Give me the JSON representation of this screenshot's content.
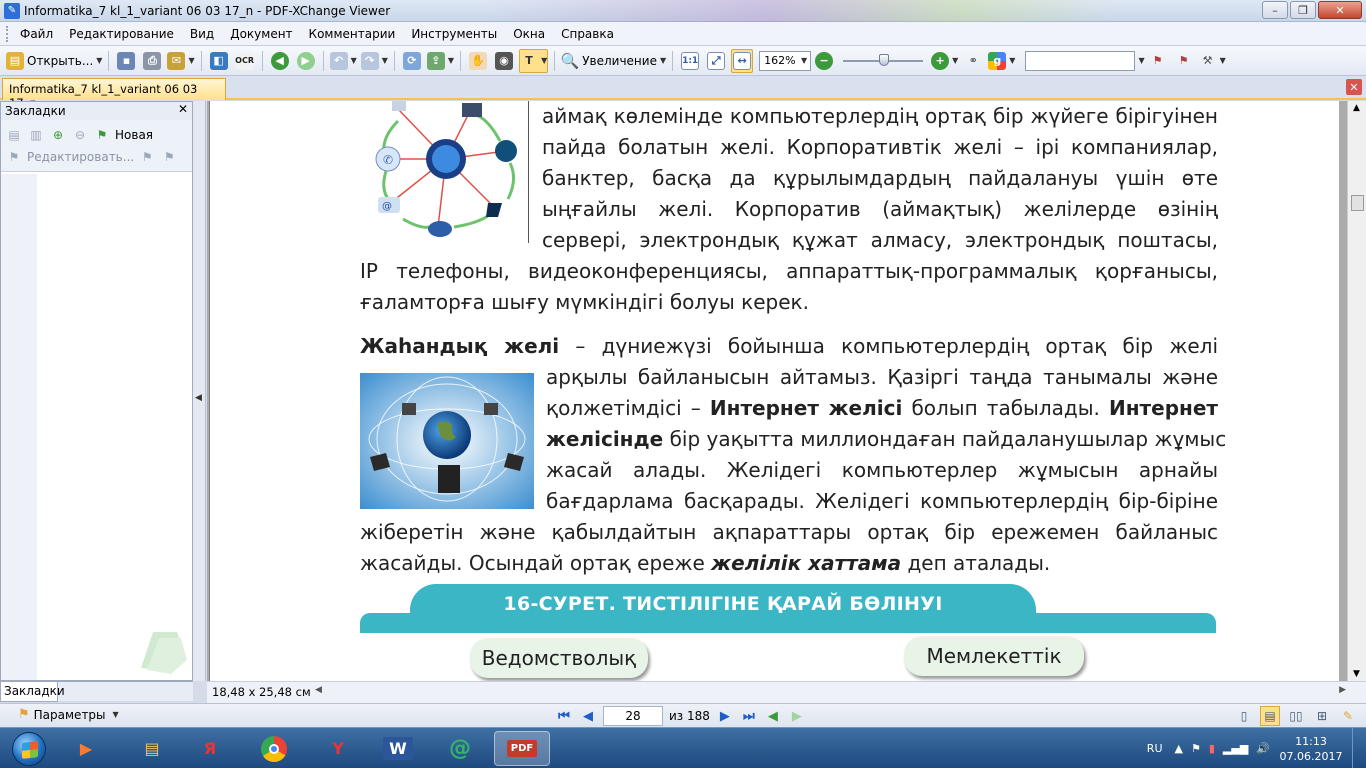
{
  "window": {
    "title": "Informatika_7 kl_1_variant  06 03 17_n - PDF-XChange Viewer",
    "controls": [
      "–",
      "❐",
      "✕"
    ]
  },
  "menu": [
    "Файл",
    "Редактирование",
    "Вид",
    "Документ",
    "Комментарии",
    "Инструменты",
    "Окна",
    "Справка"
  ],
  "toolbar": {
    "open_label": "Открыть...",
    "zoom_label": "Увеличение",
    "zoom_value": "162%",
    "ocr_label": "OCR"
  },
  "tab": {
    "label": "Informatika_7 kl_1_variant  06 03 17_n"
  },
  "bookmarks": {
    "header": "Закладки",
    "new_label": "Новая",
    "edit_label": "Редактировать...",
    "footer_tab": "Закладки"
  },
  "document": {
    "para1": [
      "аймақ көлемінде компьютерлердің ортақ бір жүйеге бірігуінен",
      "пайда болатын желі. Корпоративтік желі – ірі компаниялар,",
      "банктер, басқа да құрылымдардың пайдалануы үшін өте",
      "ыңғайлы желі. Корпоратив (аймақтық) желілерде өзінің",
      "сервері, электрондық құжат алмасу, электрондық поштасы,",
      "IP телефоны, видеоконференциясы, аппараттық-программалық қорғанысы,",
      "ғаламторға шығу мүмкіндігі болуы керек."
    ],
    "p2_term": "Жаһандық желі",
    "p2_line1_rest": " – дүниежүзі бойынша компьютерлердің ортақ бір желі",
    "p2_line2": "арқылы байланысын айтамыз. Қазіргі таңда танымалы және",
    "p2_line3_a": "қолжетімдісі – ",
    "p2_line3_b": "Интернет желісі",
    "p2_line3_c": " болып табылады. ",
    "p2_line3_d": "Интернет",
    "p2_line4_a": "желісінде",
    "p2_line4_b": " бір уақытта миллиондаған пайдаланушылар жұмыс",
    "p2_line5": "жасай алады. Желідегі компьютерлер жұмысын арнайы",
    "p2_line6": "бағдарлама басқарады. Желідегі компьютерлердің бір-біріне",
    "p2_line7": "жіберетін және қабылдайтын ақпараттары ортақ бір ережемен байланыс",
    "p2_line8_a": "жасайды. Осындай ортақ ереже ",
    "p2_line8_b": "желілік хаттама",
    "p2_line8_c": " деп аталады.",
    "figure_caption": "16-СУРЕТ. ТИСТІЛІГІНЕ ҚАРАЙ БӨЛІНУІ",
    "pill_left": "Ведомстволық",
    "pill_right": "Мемлекеттік"
  },
  "status": {
    "page_size": "18,48 x 25,48 см",
    "params_label": "Параметры",
    "current_page": "28",
    "of_pages": "из 188"
  },
  "taskbar": {
    "lang": "RU",
    "time": "11:13",
    "date": "07.06.2017",
    "apps": [
      "media-player",
      "file-explorer",
      "yandex",
      "chrome",
      "yandex-browser",
      "word",
      "mail-agent",
      "pdf-xchange"
    ]
  },
  "colors": {
    "band": "#3bb6c4",
    "pill_bg": "#e7f4e7",
    "tab_active": "#ffe08c"
  }
}
